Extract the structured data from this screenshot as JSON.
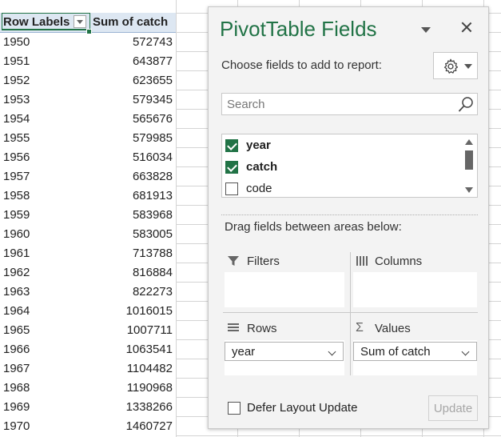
{
  "pivot": {
    "header": {
      "row_labels": "Row Labels",
      "sum_label": "Sum of catch"
    },
    "rows": [
      {
        "year": "1950",
        "value": "572743"
      },
      {
        "year": "1951",
        "value": "643877"
      },
      {
        "year": "1952",
        "value": "623655"
      },
      {
        "year": "1953",
        "value": "579345"
      },
      {
        "year": "1954",
        "value": "565676"
      },
      {
        "year": "1955",
        "value": "579985"
      },
      {
        "year": "1956",
        "value": "516034"
      },
      {
        "year": "1957",
        "value": "663828"
      },
      {
        "year": "1958",
        "value": "681913"
      },
      {
        "year": "1959",
        "value": "583968"
      },
      {
        "year": "1960",
        "value": "583005"
      },
      {
        "year": "1961",
        "value": "713788"
      },
      {
        "year": "1962",
        "value": "816884"
      },
      {
        "year": "1963",
        "value": "822273"
      },
      {
        "year": "1964",
        "value": "1016015"
      },
      {
        "year": "1965",
        "value": "1007711"
      },
      {
        "year": "1966",
        "value": "1063541"
      },
      {
        "year": "1967",
        "value": "1104482"
      },
      {
        "year": "1968",
        "value": "1190968"
      },
      {
        "year": "1969",
        "value": "1338266"
      },
      {
        "year": "1970",
        "value": "1460727"
      }
    ]
  },
  "pane": {
    "title": "PivotTable Fields",
    "choose_label": "Choose fields to add to report:",
    "search": {
      "placeholder": "Search",
      "value": ""
    },
    "fields": [
      {
        "label": "year",
        "checked": true
      },
      {
        "label": "catch",
        "checked": true
      },
      {
        "label": "code",
        "checked": false
      }
    ],
    "drag_label": "Drag fields between areas below:",
    "areas": {
      "filters": {
        "label": "Filters",
        "items": []
      },
      "columns": {
        "label": "Columns",
        "items": []
      },
      "rows": {
        "label": "Rows",
        "items": [
          "year"
        ]
      },
      "values": {
        "label": "Values",
        "items": [
          "Sum of catch"
        ]
      }
    },
    "defer_label": "Defer Layout Update",
    "defer_checked": false,
    "update_label": "Update"
  },
  "colors": {
    "accent": "#217346",
    "header_fill": "#dde7f2",
    "pane_bg": "#f3f3f3",
    "disabled_text": "#a6a6a6"
  },
  "icons": {
    "menu": "chevron-down-icon",
    "close": "close-icon",
    "tools": "gear-icon",
    "search": "search-icon",
    "filters": "filter-icon",
    "columns": "columns-icon",
    "rows": "rows-icon",
    "values": "sigma-icon"
  }
}
